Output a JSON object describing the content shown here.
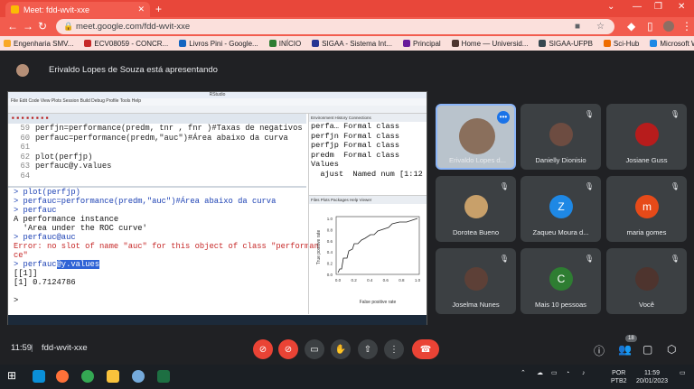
{
  "browser": {
    "tab_title": "Meet: fdd-wvit-xxe",
    "url": "meet.google.com/fdd-wvit-xxe"
  },
  "bookmarks": [
    "Engenharia SMV...",
    "ECV08059 - CONCR...",
    "Livros Pini - Google...",
    "INÍCIO",
    "SIGAA - Sistema Int...",
    "Principal",
    "Home — Universid...",
    "SIGAA-UFPB",
    "Sci-Hub",
    "Microsoft Word - A..."
  ],
  "banner": {
    "text": "Erivaldo Lopes de Souza está apresentando"
  },
  "rstudio": {
    "title": "RStudio",
    "menu": "File  Edit  Code  View  Plots  Session  Build  Debug  Profile  Tools  Help",
    "source_lines": [
      {
        "n": "59",
        "code": "perfjn=performance(predm, tnr , fnr )#Taxas de negativos"
      },
      {
        "n": "60",
        "code": "perfauc=performance(predm,\"auc\")#Área abaixo da curva"
      },
      {
        "n": "61",
        "code": ""
      },
      {
        "n": "62",
        "code": "plot(perfjp)"
      },
      {
        "n": "63",
        "code": "perfauc@y.values"
      },
      {
        "n": "64",
        "code": ""
      }
    ],
    "console": [
      {
        "t": "> plot(perfjp)",
        "c": "blue"
      },
      {
        "t": "> perfauc=performance(predm,\"auc\")#Área abaixo da curva",
        "c": "blue"
      },
      {
        "t": "> perfauc",
        "c": "blue"
      },
      {
        "t": "A performance instance",
        "c": "blk"
      },
      {
        "t": "  'Area under the ROC curve'",
        "c": "blk"
      },
      {
        "t": "> perfauc@auc",
        "c": "blue"
      },
      {
        "t": "Error: no slot of name \"auc\" for this object of class \"performan",
        "c": "red"
      },
      {
        "t": "ce\"",
        "c": "red"
      }
    ],
    "console_sel_prefix": "> perfauc",
    "console_sel": "@y.values",
    "console_tail": [
      "[[1]]",
      "[1] 0.7124786",
      "",
      ">"
    ],
    "env_tabs": "Environment  History  Connections",
    "env_lines": [
      "perfa… Formal class",
      "perfjn Formal class",
      "perfjp Formal class",
      "predm  Formal class",
      "Values",
      "  ajust  Named num [1:12"
    ],
    "plot_tabs": "Files  Plots  Packages  Help  Viewer",
    "plot": {
      "xlabel": "False positive rate",
      "ylabel": "True positive rate",
      "ticks": [
        "0.0",
        "0.2",
        "0.4",
        "0.6",
        "0.8",
        "1.0"
      ]
    }
  },
  "participants": [
    {
      "name": "Erivaldo Lopes d...",
      "color": "#a9b8c8"
    },
    {
      "name": "Danielly Dionisio",
      "color": "#6d4c41"
    },
    {
      "name": "Josiane Guss",
      "color": "#b71c1c"
    },
    {
      "name": "Dorotea Bueno",
      "color": "#c8a06a"
    },
    {
      "name": "Zaqueu Moura d...",
      "letter": "Z",
      "color": "#1e88e5"
    },
    {
      "name": "maria gomes",
      "letter": "m",
      "color": "#e64a19"
    },
    {
      "name": "Joselma Nunes",
      "color": "#5d4037"
    },
    {
      "name": "Mais 10 pessoas",
      "letter": "C",
      "color": "#2e7d32"
    },
    {
      "name": "Você",
      "color": "#4e342e"
    }
  ],
  "meet": {
    "time": "11:59",
    "code": "fdd-wvit-xxe",
    "badge": "18"
  },
  "taskbar": {
    "lang": "POR",
    "layout": "PTB2",
    "clock": "11:59",
    "date": "20/01/2023"
  }
}
